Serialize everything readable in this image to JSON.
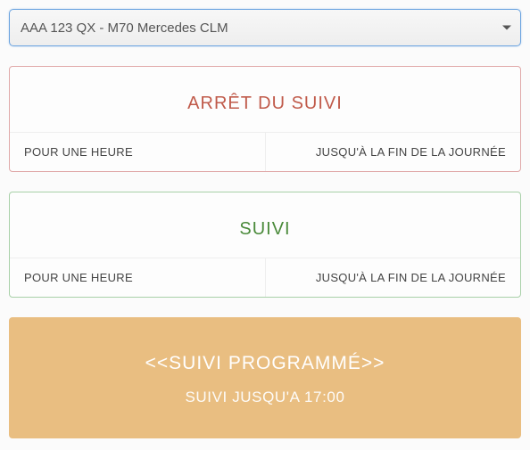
{
  "dropdown": {
    "selected": "AAA 123 QX - M70 Mercedes CLM"
  },
  "stop": {
    "title": "ARRÊT DU SUIVI",
    "hour": "POUR UNE HEURE",
    "day": "JUSQU'À LA FIN DE LA JOURNÉE"
  },
  "track": {
    "title": "SUIVI",
    "hour": "POUR UNE HEURE",
    "day": "JUSQU'À LA FIN DE LA JOURNÉE"
  },
  "scheduled": {
    "title": "<<SUIVI PROGRAMMÉ>>",
    "subtitle": "SUIVI JUSQU'A 17:00"
  }
}
